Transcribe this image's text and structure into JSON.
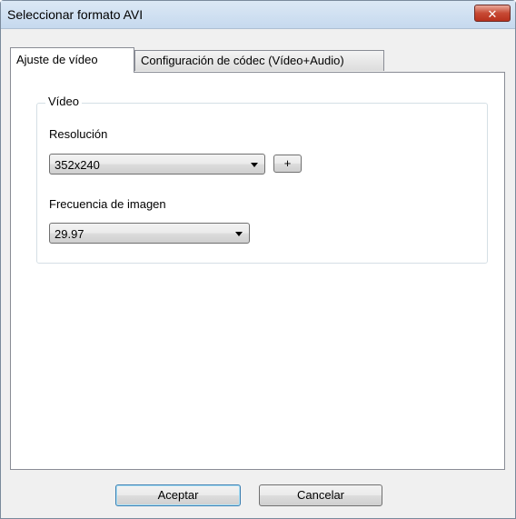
{
  "window": {
    "title": "Seleccionar formato AVI",
    "close_label": "✕"
  },
  "tabs": [
    {
      "label": "Ajuste de vídeo",
      "active": true
    },
    {
      "label": "Configuración de códec (Vídeo+Audio)",
      "active": false
    }
  ],
  "video_group": {
    "legend": "Vídeo",
    "resolution": {
      "label": "Resolución",
      "selected": "352x240",
      "add_button_label": "+"
    },
    "frame_rate": {
      "label": "Frecuencia de imagen",
      "selected": "29.97"
    }
  },
  "footer": {
    "ok_label": "Aceptar",
    "cancel_label": "Cancelar"
  }
}
